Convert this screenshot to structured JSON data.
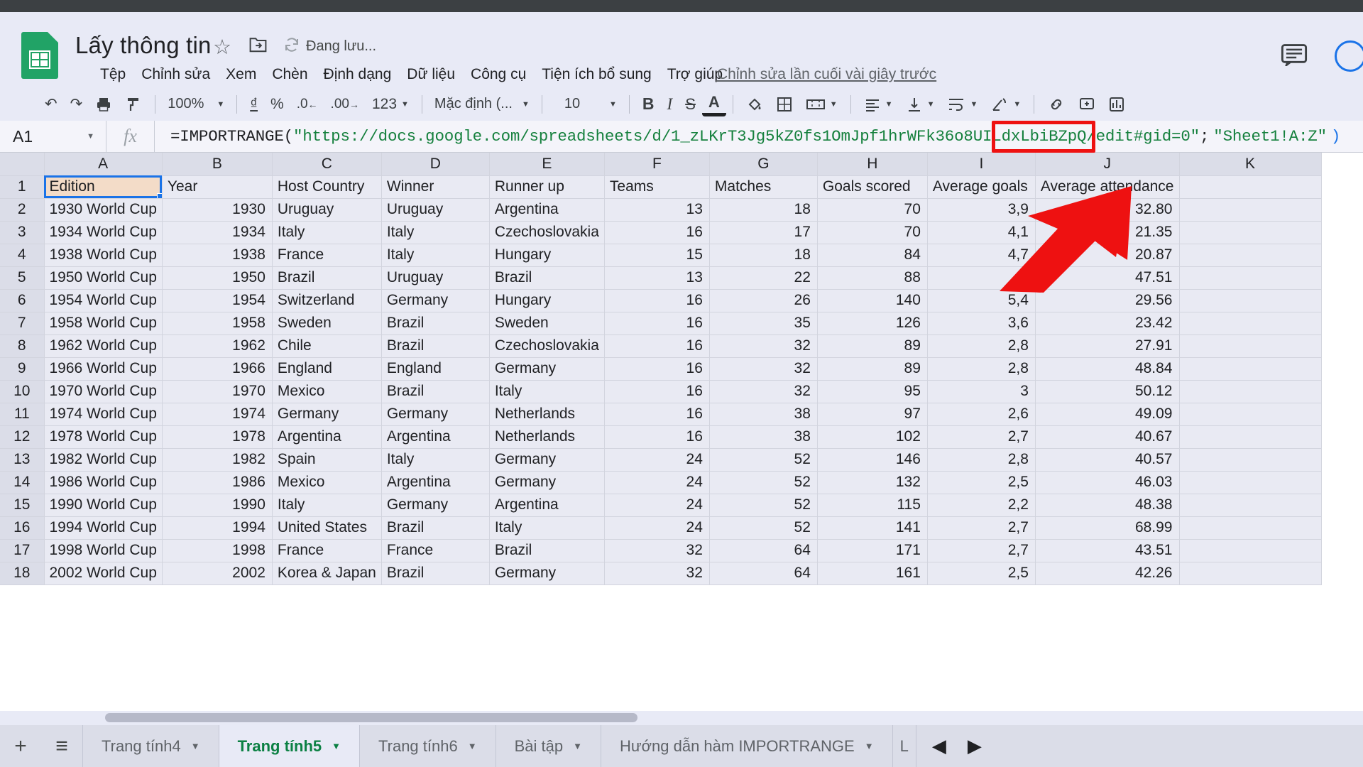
{
  "header": {
    "doc_title": "Lấy thông tin",
    "saving_status": "Đang lưu...",
    "last_edit": "Chỉnh sửa lần cuối vài giây trước",
    "star_icon": "star-icon",
    "move_icon": "move-to-folder-icon",
    "cloud_icon": "sync-icon",
    "menus": [
      "Tệp",
      "Chỉnh sửa",
      "Xem",
      "Chèn",
      "Định dạng",
      "Dữ liệu",
      "Công cụ",
      "Tiện ích bổ sung",
      "Trợ giúp"
    ]
  },
  "toolbar": {
    "undo": "↶",
    "redo": "↷",
    "print": "print-icon",
    "paint": "paint-format-icon",
    "zoom": "100%",
    "currency": "₫",
    "percent": "%",
    "dec_decrease": ".0",
    "dec_increase": ".00",
    "number_format": "123",
    "font": "Mặc định (...",
    "font_size": "10",
    "bold": "B",
    "italic": "I",
    "strikethrough": "S",
    "text_color": "A",
    "fill_color": "fill-color-icon",
    "borders": "borders-icon",
    "merge": "merge-cells-icon",
    "halign": "horizontal-align-icon",
    "valign": "vertical-align-icon",
    "wrap": "text-wrap-icon",
    "rotate": "text-rotation-icon",
    "link": "insert-link-icon",
    "comment": "insert-comment-icon",
    "chart": "insert-chart-icon"
  },
  "formula_bar": {
    "name_box": "A1",
    "fx_label": "fx",
    "formula_prefix": "=IMPORTRANGE(",
    "formula_url": "\"https://docs.google.com/spreadsheets/d/1_zLKrT3Jg5kZ0fs1OmJpf1hrWFk36o8UILdxLbiBZpQ/edit#gid=0\"",
    "formula_separator": "; ",
    "formula_range": "\"Sheet1!A:Z\"",
    "formula_suffix": ")",
    "highlight_color": "#ee1111"
  },
  "grid": {
    "columns": [
      "A",
      "B",
      "C",
      "D",
      "E",
      "F",
      "G",
      "H",
      "I",
      "J",
      "K"
    ],
    "headers": [
      "Edition",
      "Year",
      "Host Country",
      "Winner",
      "Runner up",
      "Teams",
      "Matches",
      "Goals scored",
      "Average goals",
      "Average attendance",
      ""
    ],
    "selected_cell": "A1",
    "rows": [
      {
        "n": "2",
        "cells": [
          "1930 World Cup",
          "1930",
          "Uruguay",
          "Uruguay",
          "Argentina",
          "13",
          "18",
          "70",
          "3,9",
          "32.80",
          ""
        ]
      },
      {
        "n": "3",
        "cells": [
          "1934 World Cup",
          "1934",
          "Italy",
          "Italy",
          "Czechoslovakia",
          "16",
          "17",
          "70",
          "4,1",
          "21.35",
          ""
        ]
      },
      {
        "n": "4",
        "cells": [
          "1938 World Cup",
          "1938",
          "France",
          "Italy",
          "Hungary",
          "15",
          "18",
          "84",
          "4,7",
          "20.87",
          ""
        ]
      },
      {
        "n": "5",
        "cells": [
          "1950 World Cup",
          "1950",
          "Brazil",
          "Uruguay",
          "Brazil",
          "13",
          "22",
          "88",
          "4",
          "47.51",
          ""
        ]
      },
      {
        "n": "6",
        "cells": [
          "1954 World Cup",
          "1954",
          "Switzerland",
          "Germany",
          "Hungary",
          "16",
          "26",
          "140",
          "5,4",
          "29.56",
          ""
        ]
      },
      {
        "n": "7",
        "cells": [
          "1958 World Cup",
          "1958",
          "Sweden",
          "Brazil",
          "Sweden",
          "16",
          "35",
          "126",
          "3,6",
          "23.42",
          ""
        ]
      },
      {
        "n": "8",
        "cells": [
          "1962 World Cup",
          "1962",
          "Chile",
          "Brazil",
          "Czechoslovakia",
          "16",
          "32",
          "89",
          "2,8",
          "27.91",
          ""
        ]
      },
      {
        "n": "9",
        "cells": [
          "1966 World Cup",
          "1966",
          "England",
          "England",
          "Germany",
          "16",
          "32",
          "89",
          "2,8",
          "48.84",
          ""
        ]
      },
      {
        "n": "10",
        "cells": [
          "1970 World Cup",
          "1970",
          "Mexico",
          "Brazil",
          "Italy",
          "16",
          "32",
          "95",
          "3",
          "50.12",
          ""
        ]
      },
      {
        "n": "11",
        "cells": [
          "1974 World Cup",
          "1974",
          "Germany",
          "Germany",
          "Netherlands",
          "16",
          "38",
          "97",
          "2,6",
          "49.09",
          ""
        ]
      },
      {
        "n": "12",
        "cells": [
          "1978 World Cup",
          "1978",
          "Argentina",
          "Argentina",
          "Netherlands",
          "16",
          "38",
          "102",
          "2,7",
          "40.67",
          ""
        ]
      },
      {
        "n": "13",
        "cells": [
          "1982 World Cup",
          "1982",
          "Spain",
          "Italy",
          "Germany",
          "24",
          "52",
          "146",
          "2,8",
          "40.57",
          ""
        ]
      },
      {
        "n": "14",
        "cells": [
          "1986 World Cup",
          "1986",
          "Mexico",
          "Argentina",
          "Germany",
          "24",
          "52",
          "132",
          "2,5",
          "46.03",
          ""
        ]
      },
      {
        "n": "15",
        "cells": [
          "1990 World Cup",
          "1990",
          "Italy",
          "Germany",
          "Argentina",
          "24",
          "52",
          "115",
          "2,2",
          "48.38",
          ""
        ]
      },
      {
        "n": "16",
        "cells": [
          "1994 World Cup",
          "1994",
          "United States",
          "Brazil",
          "Italy",
          "24",
          "52",
          "141",
          "2,7",
          "68.99",
          ""
        ]
      },
      {
        "n": "17",
        "cells": [
          "1998 World Cup",
          "1998",
          "France",
          "France",
          "Brazil",
          "32",
          "64",
          "171",
          "2,7",
          "43.51",
          ""
        ]
      },
      {
        "n": "18",
        "cells": [
          "2002 World Cup",
          "2002",
          "Korea & Japan",
          "Brazil",
          "Germany",
          "32",
          "64",
          "161",
          "2,5",
          "42.26",
          ""
        ]
      }
    ]
  },
  "tabs": {
    "add_label": "+",
    "all_sheets_label": "≡",
    "items": [
      {
        "label": "Trang tính4",
        "active": false
      },
      {
        "label": "Trang tính5",
        "active": true
      },
      {
        "label": "Trang tính6",
        "active": false
      },
      {
        "label": "Bài tập",
        "active": false
      },
      {
        "label": "Hướng dẫn hàm IMPORTRANGE",
        "active": false
      },
      {
        "label": "L",
        "active": false
      }
    ],
    "prev_arrow": "◀",
    "next_arrow": "▶"
  },
  "annotation": {
    "arrow_color": "#ee1111",
    "arrow_name": "red-pointer-arrow"
  }
}
